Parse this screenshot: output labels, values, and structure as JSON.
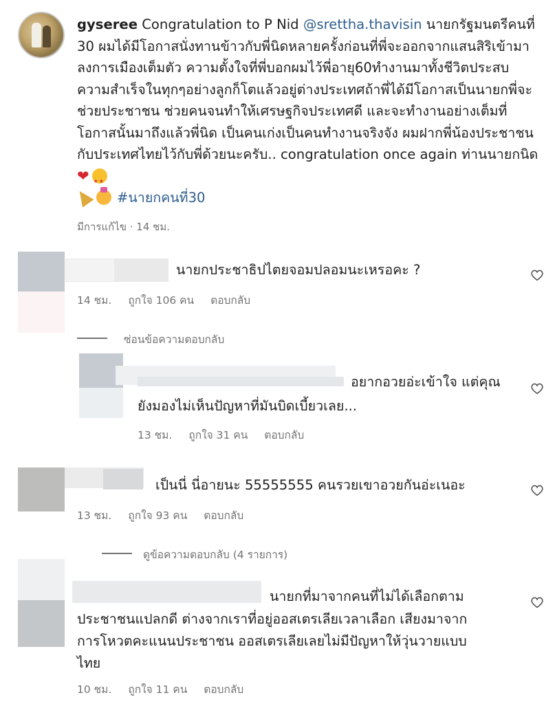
{
  "post": {
    "username": "gyseree",
    "caption_lead": " Congratulation to P Nid ",
    "mention": "@srettha.thavisin",
    "caption_body": " นายกรัฐมนตรีคนที่ 30 ผมได้มีโอกาสนั่งทานข้าวกับพี่นิดหลายครั้งก่อนที่พี่จะออกจากแสนสิริเข้ามาลงการเมืองเต็มตัว ความตั้งใจที่พี่บอกผมไว้พี่อายุ60ทำงานมาทั้งชีวิตประสบความสำเร็จในทุกๆอย่างลูกก็โตแล้วอยู่ต่างประเทศถ้าพี่ได้มีโอกาสเป็นนายกพี่จะช่วยประชาชน ช่วยคนจนทำให้เศรษฐกิจประเทศดี และจะทำงานอย่างเต็มที่ โอกาสนั้นมาถึงแล้วพี่นิด เป็นคนเก่งเป็นคนทำงานจริงจัง ผมฝากพี่น้องประชาชนกับประเทศไทยไว้กับพี่ด้วยนะครับ.. congratulation once again ท่านนายกนิด",
    "hashtag": "#นายกคนที่30",
    "edited": "มีการแก้ไข · 14 ชม.",
    "emoji_names": [
      "red-heart-icon",
      "star-struck-face-icon",
      "party-popper-icon",
      "partying-face-icon"
    ]
  },
  "comments": [
    {
      "text": "นายกประชาธิปไตยจอมปลอมนะเหรอคะ ?",
      "time": "14 ชม.",
      "likes": "ถูกใจ 106 คน",
      "reply": "ตอบกลับ"
    }
  ],
  "thread1_toggle": "ซ่อนข้อความตอบกลับ",
  "reply1": {
    "text_line1": "อยากอวยอ่ะเข้าใจ แต่คุณ",
    "text_line2": "ยังมองไม่เห็นปัญหาที่มันบิดเบี้ยวเลย...",
    "time": "13 ชม.",
    "likes": "ถูกใจ 31 คน",
    "reply": "ตอบกลับ"
  },
  "comment2": {
    "text": "เป็นนี่ นี่อายนะ 55555555 คนรวยเขาอวยกันอ่ะเนอะ",
    "time": "13 ชม.",
    "likes": "ถูกใจ 93 คน",
    "reply": "ตอบกลับ"
  },
  "thread2_toggle": "ดูข้อความตอบกลับ (4 รายการ)",
  "comment3": {
    "line1": "นายกที่มาจากคนที่ไม่ได้เลือกตาม",
    "line2": "ประชาชนแปลกดี ต่างจากเราที่อยู่ออสเตรเลียเวลาเลือก เสียงมาจาก",
    "line3": "การโหวตคะแนนประชาชน ออสเตรเลียเลยไม่มีปัญหาให้วุ่นวายแบบ",
    "line4": "ไทย",
    "time": "10 ชม.",
    "likes": "ถูกใจ 11 คน",
    "reply": "ตอบกลับ"
  },
  "colors": {
    "mention": "#2e5d8e",
    "muted": "#737373",
    "text": "#1f1f1f"
  }
}
